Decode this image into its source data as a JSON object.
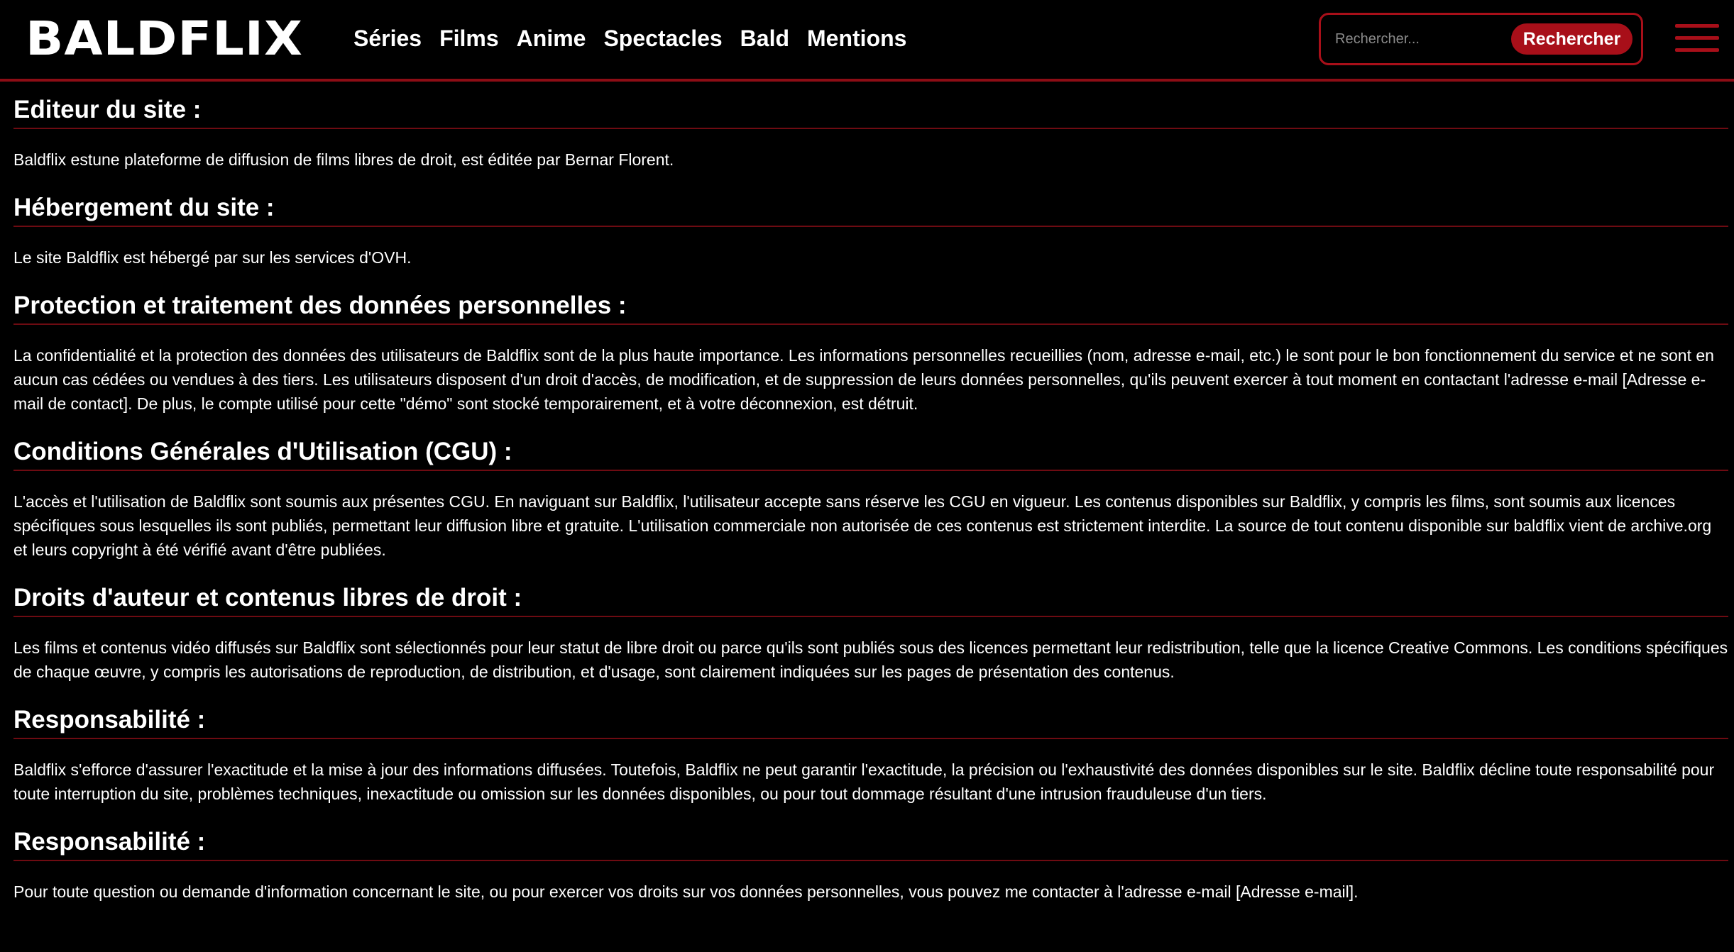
{
  "header": {
    "logo": "BALDFLIX",
    "nav": [
      "Séries",
      "Films",
      "Anime",
      "Spectacles",
      "Bald",
      "Mentions"
    ],
    "search": {
      "placeholder": "Rechercher...",
      "value": "",
      "button_label": "Rechercher"
    },
    "menu_icon": "hamburger-menu-icon"
  },
  "colors": {
    "accent": "#a80f19",
    "background": "#000000",
    "text": "#ffffff"
  },
  "sections": [
    {
      "title": "Editeur du site :",
      "text": "Baldflix estune plateforme de diffusion de films libres de droit, est éditée par Bernar Florent."
    },
    {
      "title": "Hébergement du site :",
      "text": "Le site Baldflix est hébergé par sur les services d'OVH."
    },
    {
      "title": "Protection et traitement des données personnelles :",
      "text": "La confidentialité et la protection des données des utilisateurs de Baldflix sont de la plus haute importance. Les informations personnelles recueillies (nom, adresse e-mail, etc.) le sont pour le bon fonctionnement du service et ne sont en aucun cas cédées ou vendues à des tiers. Les utilisateurs disposent d'un droit d'accès, de modification, et de suppression de leurs données personnelles, qu'ils peuvent exercer à tout moment en contactant l'adresse e-mail [Adresse e-mail de contact]. De plus, le compte utilisé pour cette \"démo\" sont stocké temporairement, et à votre déconnexion, est détruit."
    },
    {
      "title": "Conditions Générales d'Utilisation (CGU) :",
      "text": "L'accès et l'utilisation de Baldflix sont soumis aux présentes CGU. En naviguant sur Baldflix, l'utilisateur accepte sans réserve les CGU en vigueur. Les contenus disponibles sur Baldflix, y compris les films, sont soumis aux licences spécifiques sous lesquelles ils sont publiés, permettant leur diffusion libre et gratuite. L'utilisation commerciale non autorisée de ces contenus est strictement interdite. La source de tout contenu disponible sur baldflix vient de archive.org et leurs copyright à été vérifié avant d'être publiées."
    },
    {
      "title": "Droits d'auteur et contenus libres de droit :",
      "text": "Les films et contenus vidéo diffusés sur Baldflix sont sélectionnés pour leur statut de libre droit ou parce qu'ils sont publiés sous des licences permettant leur redistribution, telle que la licence Creative Commons. Les conditions spécifiques de chaque œuvre, y compris les autorisations de reproduction, de distribution, et d'usage, sont clairement indiquées sur les pages de présentation des contenus."
    },
    {
      "title": "Responsabilité :",
      "text": "Baldflix s'efforce d'assurer l'exactitude et la mise à jour des informations diffusées. Toutefois, Baldflix ne peut garantir l'exactitude, la précision ou l'exhaustivité des données disponibles sur le site. Baldflix décline toute responsabilité pour toute interruption du site, problèmes techniques, inexactitude ou omission sur les données disponibles, ou pour tout dommage résultant d'une intrusion frauduleuse d'un tiers."
    },
    {
      "title": "Responsabilité :",
      "text": "Pour toute question ou demande d'information concernant le site, ou pour exercer vos droits sur vos données personnelles, vous pouvez me contacter à l'adresse e-mail [Adresse e-mail]."
    }
  ]
}
